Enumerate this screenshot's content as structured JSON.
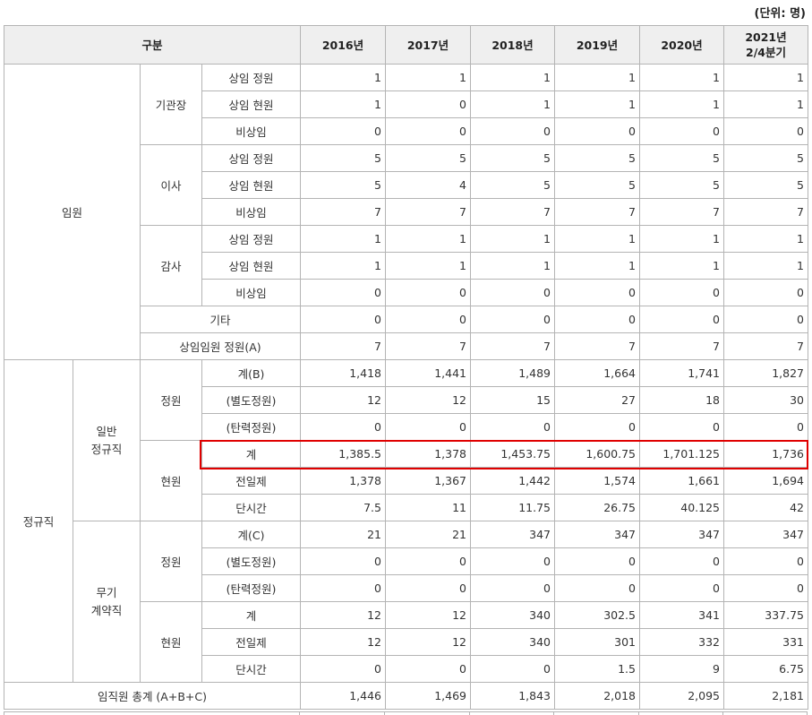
{
  "unit_label": "(단위: 명)",
  "header": {
    "category": "구분",
    "years": [
      "2016년",
      "2017년",
      "2018년",
      "2019년",
      "2020년",
      "2021년\n2/4분기"
    ]
  },
  "labels": {
    "executives": "임원",
    "institution_head": "기관장",
    "director": "이사",
    "auditor": "감사",
    "standing_quota": "상임 정원",
    "standing_current": "상임 현원",
    "non_standing": "비상임",
    "other": "기타",
    "standing_exec_quota": "상임임원 정원(A)",
    "regular": "정규직",
    "general_regular": "일반\n정규직",
    "quota": "정원",
    "current": "현원",
    "total_b": "계(B)",
    "separate_quota": "(별도정원)",
    "flexible_quota": "(탄력정원)",
    "total": "계",
    "full_time": "전일제",
    "part_time": "단시간",
    "indefinite_contract": "무기\n계약직",
    "total_c": "계(C)",
    "grand_total": "임직원 총계 (A+B+C)"
  },
  "values": {
    "head_quota": [
      "1",
      "1",
      "1",
      "1",
      "1",
      "1"
    ],
    "head_current": [
      "1",
      "0",
      "1",
      "1",
      "1",
      "1"
    ],
    "head_nonstanding": [
      "0",
      "0",
      "0",
      "0",
      "0",
      "0"
    ],
    "dir_quota": [
      "5",
      "5",
      "5",
      "5",
      "5",
      "5"
    ],
    "dir_current": [
      "5",
      "4",
      "5",
      "5",
      "5",
      "5"
    ],
    "dir_nonstanding": [
      "7",
      "7",
      "7",
      "7",
      "7",
      "7"
    ],
    "aud_quota": [
      "1",
      "1",
      "1",
      "1",
      "1",
      "1"
    ],
    "aud_current": [
      "1",
      "1",
      "1",
      "1",
      "1",
      "1"
    ],
    "aud_nonstanding": [
      "0",
      "0",
      "0",
      "0",
      "0",
      "0"
    ],
    "other": [
      "0",
      "0",
      "0",
      "0",
      "0",
      "0"
    ],
    "standing_exec_quota": [
      "7",
      "7",
      "7",
      "7",
      "7",
      "7"
    ],
    "gen_quota_total": [
      "1,418",
      "1,441",
      "1,489",
      "1,664",
      "1,741",
      "1,827"
    ],
    "gen_quota_separate": [
      "12",
      "12",
      "15",
      "27",
      "18",
      "30"
    ],
    "gen_quota_flexible": [
      "0",
      "0",
      "0",
      "0",
      "0",
      "0"
    ],
    "gen_current_total": [
      "1,385.5",
      "1,378",
      "1,453.75",
      "1,600.75",
      "1,701.125",
      "1,736"
    ],
    "gen_current_fulltime": [
      "1,378",
      "1,367",
      "1,442",
      "1,574",
      "1,661",
      "1,694"
    ],
    "gen_current_parttime": [
      "7.5",
      "11",
      "11.75",
      "26.75",
      "40.125",
      "42"
    ],
    "ind_quota_total": [
      "21",
      "21",
      "347",
      "347",
      "347",
      "347"
    ],
    "ind_quota_separate": [
      "0",
      "0",
      "0",
      "0",
      "0",
      "0"
    ],
    "ind_quota_flexible": [
      "0",
      "0",
      "0",
      "0",
      "0",
      "0"
    ],
    "ind_current_total": [
      "12",
      "12",
      "340",
      "302.5",
      "341",
      "337.75"
    ],
    "ind_current_fulltime": [
      "12",
      "12",
      "340",
      "301",
      "332",
      "331"
    ],
    "ind_current_parttime": [
      "0",
      "0",
      "0",
      "1.5",
      "9",
      "6.75"
    ],
    "grand_total": [
      "1,446",
      "1,469",
      "1,843",
      "2,018",
      "2,095",
      "2,181"
    ]
  },
  "highlight_color": "#e00000"
}
